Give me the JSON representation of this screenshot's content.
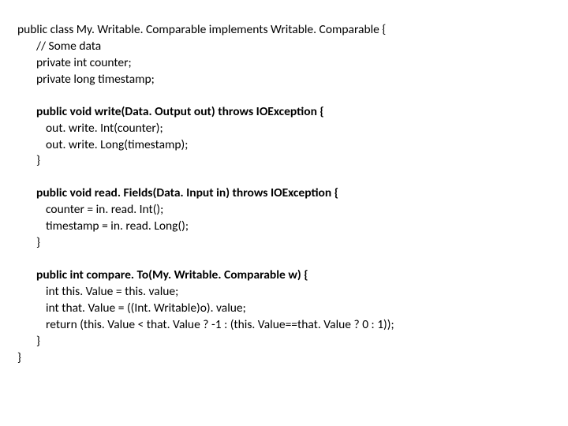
{
  "code": {
    "l1": "public class My. Writable. Comparable implements Writable. Comparable {",
    "l2": "// Some data",
    "l3": "private int counter;",
    "l4": "private long timestamp;",
    "l5": "public void write(Data. Output out) throws IOException {",
    "l6": "out. write. Int(counter);",
    "l7": "out. write. Long(timestamp);",
    "l8": "}",
    "l9": "public void read. Fields(Data. Input in) throws IOException {",
    "l10": "counter = in. read. Int();",
    "l11": "timestamp = in. read. Long();",
    "l12": "}",
    "l13": "public int compare. To(My. Writable. Comparable w) {",
    "l14": "int this. Value = this. value;",
    "l15": "int that. Value = ((Int. Writable)o). value;",
    "l16": "return (this. Value < that. Value ? -1 : (this. Value==that. Value ? 0 : 1));",
    "l17": "}",
    "l18": "}"
  }
}
